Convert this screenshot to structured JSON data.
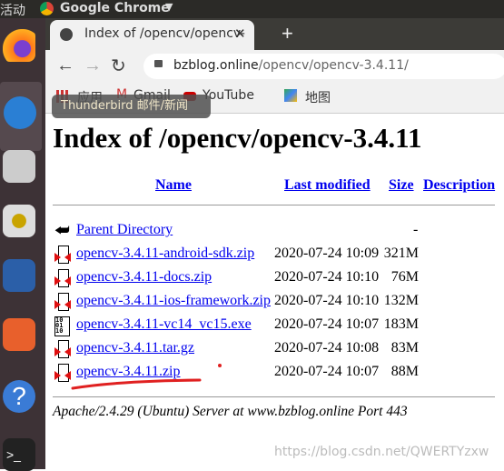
{
  "system": {
    "activities": "活动",
    "app_menu": "Google Chrome"
  },
  "browser": {
    "tab_title": "Index of /opencv/opencv-",
    "url_host": "bzblog.online",
    "url_path": "/opencv/opencv-3.4.11/",
    "bookmarks": [
      {
        "label": "应用",
        "icon": "apps-icon"
      },
      {
        "label": "Gmail",
        "icon": "gmail-icon"
      },
      {
        "label": "YouTube",
        "icon": "youtube-icon"
      },
      {
        "label": "地图",
        "icon": "maps-icon"
      }
    ],
    "tooltip": "Thunderbird 邮件/新闻"
  },
  "page": {
    "title": "Index of /opencv/opencv-3.4.11",
    "columns": [
      "Name",
      "Last modified",
      "Size",
      "Description"
    ],
    "parent": {
      "name": "Parent Directory",
      "size": "-"
    },
    "files": [
      {
        "name": "opencv-3.4.11-android-sdk.zip",
        "modified": "2020-07-24 10:09",
        "size": "321M",
        "icon": "archive-icon"
      },
      {
        "name": "opencv-3.4.11-docs.zip",
        "modified": "2020-07-24 10:10",
        "size": "76M",
        "icon": "archive-icon"
      },
      {
        "name": "opencv-3.4.11-ios-framework.zip",
        "modified": "2020-07-24 10:10",
        "size": "132M",
        "icon": "archive-icon"
      },
      {
        "name": "opencv-3.4.11-vc14_vc15.exe",
        "modified": "2020-07-24 10:07",
        "size": "183M",
        "icon": "binary-icon"
      },
      {
        "name": "opencv-3.4.11.tar.gz",
        "modified": "2020-07-24 10:08",
        "size": "83M",
        "icon": "archive-icon"
      },
      {
        "name": "opencv-3.4.11.zip",
        "modified": "2020-07-24 10:07",
        "size": "88M",
        "icon": "archive-icon"
      }
    ],
    "footer": "Apache/2.4.29 (Ubuntu) Server at www.bzblog.online Port 443"
  },
  "watermark": "https://blog.csdn.net/QWERTYzxw",
  "colors": {
    "link": "#0000ee",
    "annotation": "#e02020"
  }
}
